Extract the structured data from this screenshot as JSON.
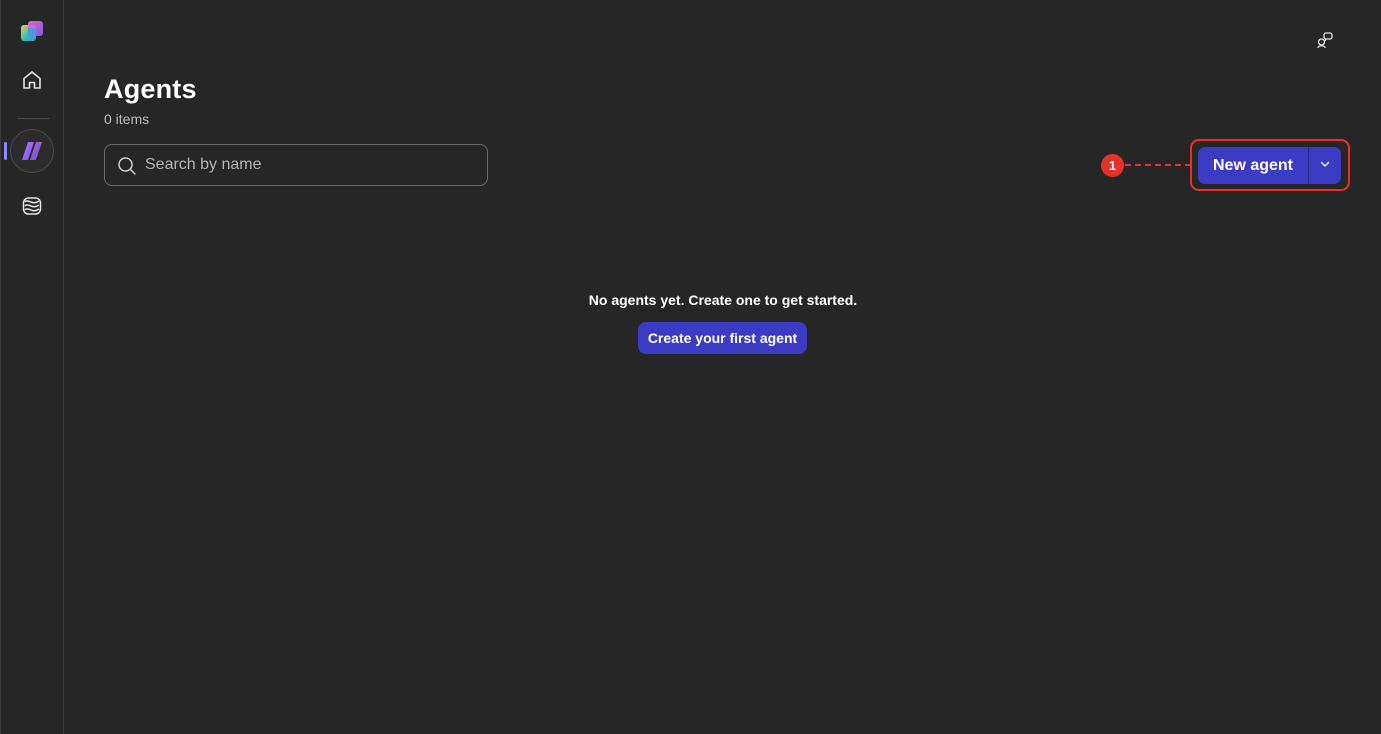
{
  "header": {
    "title": "Agents",
    "item_count": "0 items"
  },
  "search": {
    "placeholder": "Search by name",
    "value": ""
  },
  "toolbar": {
    "new_agent_label": "New agent"
  },
  "callout": {
    "number": "1"
  },
  "empty_state": {
    "message": "No agents yet. Create one to get started.",
    "button_label": "Create your first agent"
  },
  "icons": {
    "logo": "app-logo-icon",
    "home": "home-icon",
    "agents": "agents-icon",
    "models": "models-icon",
    "top_right": "feedback-icon",
    "search": "search-icon",
    "caret": "chevron-down-icon"
  },
  "colors": {
    "background": "#262626",
    "accent": "#3b3bc4",
    "callout": "#e8302a"
  }
}
